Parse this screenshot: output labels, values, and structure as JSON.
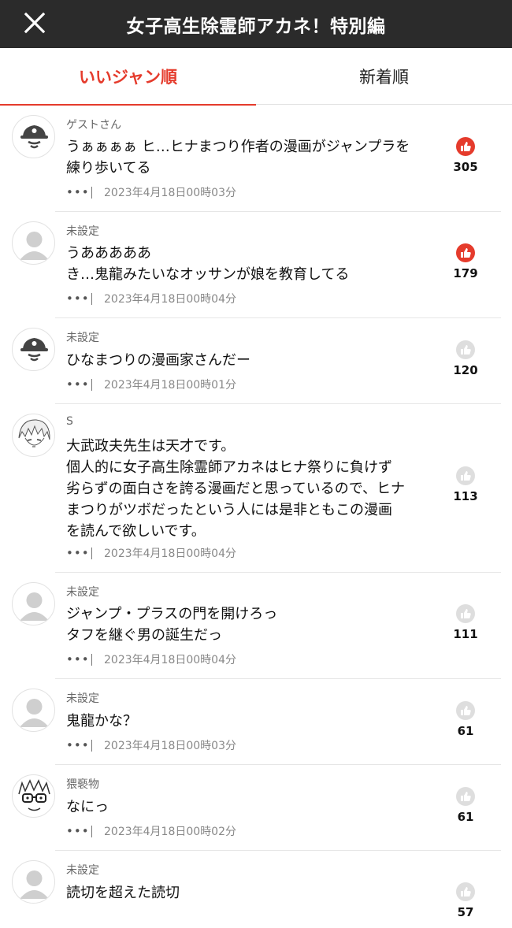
{
  "header": {
    "title": "女子高生除霊師アカネ！特別編"
  },
  "tabs": [
    {
      "label": "いいジャン順"
    },
    {
      "label": "新着順"
    }
  ],
  "colors": {
    "accent": "#e53b2c",
    "like_inactive": "#d2d2d2",
    "header_bg": "#2b2b2b"
  },
  "comments": [
    {
      "user": "ゲストさん",
      "avatar": "pirate-icon",
      "text": "うぁぁぁぁ ヒ…ヒナまつり作者の漫画がジャンプラを\n練り歩いてる",
      "date": "2023年4月18日00時03分",
      "likes": "305",
      "liked": true
    },
    {
      "user": "未設定",
      "avatar": "default-user-icon",
      "text": "うあああああ\nき…鬼龍みたいなオッサンが娘を教育してる",
      "date": "2023年4月18日00時04分",
      "likes": "179",
      "liked": true
    },
    {
      "user": "未設定",
      "avatar": "pirate-icon",
      "text": "ひなまつりの漫画家さんだー",
      "date": "2023年4月18日00時01分",
      "likes": "120",
      "liked": false
    },
    {
      "user": "S",
      "avatar": "manga-character-icon",
      "text": "大武政夫先生は天才です。\n個人的に女子高生除霊師アカネはヒナ祭りに負けず\n劣らずの面白さを誇る漫画だと思っているので、ヒナ\nまつりがツボだったという人には是非ともこの漫画\nを読んで欲しいです。",
      "date": "2023年4月18日00時04分",
      "likes": "113",
      "liked": false
    },
    {
      "user": "未設定",
      "avatar": "default-user-icon",
      "text": "ジャンプ・プラスの門を開けろっ\nタフを継ぐ男の誕生だっ",
      "date": "2023年4月18日00時04分",
      "likes": "111",
      "liked": false
    },
    {
      "user": "未設定",
      "avatar": "default-user-icon",
      "text": "鬼龍かな？",
      "date": "2023年4月18日00時03分",
      "likes": "61",
      "liked": false
    },
    {
      "user": "猥褻物",
      "avatar": "glasses-character-icon",
      "text": "なにっ",
      "date": "2023年4月18日00時02分",
      "likes": "61",
      "liked": false
    },
    {
      "user": "未設定",
      "avatar": "default-user-icon",
      "text": "読切を超えた読切",
      "date": "",
      "likes": "57",
      "liked": false
    }
  ],
  "more_label": "•••"
}
